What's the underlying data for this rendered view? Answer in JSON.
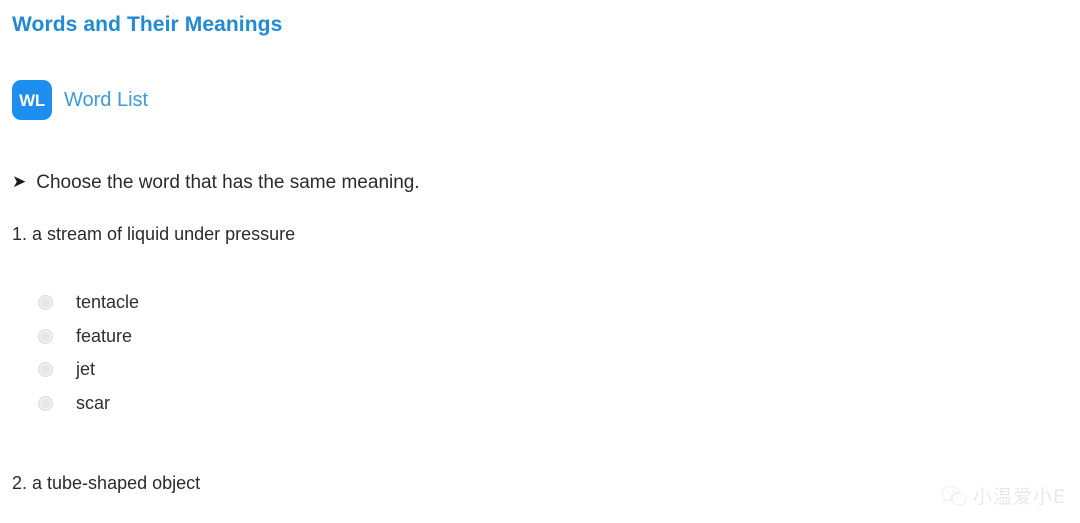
{
  "document": {
    "title": "Words and Their Meanings",
    "title_color": "#1f8ad6"
  },
  "word_list": {
    "badge_text": "WL",
    "badge_color": "#1d8ef0",
    "label": "Word List",
    "label_color": "#3b9ce0"
  },
  "instruction": {
    "arrow_glyph": "➤",
    "text": "Choose the word that has the same meaning."
  },
  "questions": [
    {
      "number": "1.",
      "prompt": "1. a stream of liquid under pressure",
      "options": [
        {
          "label": "tentacle",
          "selected": false
        },
        {
          "label": "feature",
          "selected": false
        },
        {
          "label": "jet",
          "selected": false
        },
        {
          "label": "scar",
          "selected": false
        }
      ]
    },
    {
      "number": "2.",
      "prompt": "2. a tube-shaped object",
      "options": []
    }
  ],
  "watermark": {
    "icon": "wechat-icon",
    "text": "小温爱小E"
  }
}
